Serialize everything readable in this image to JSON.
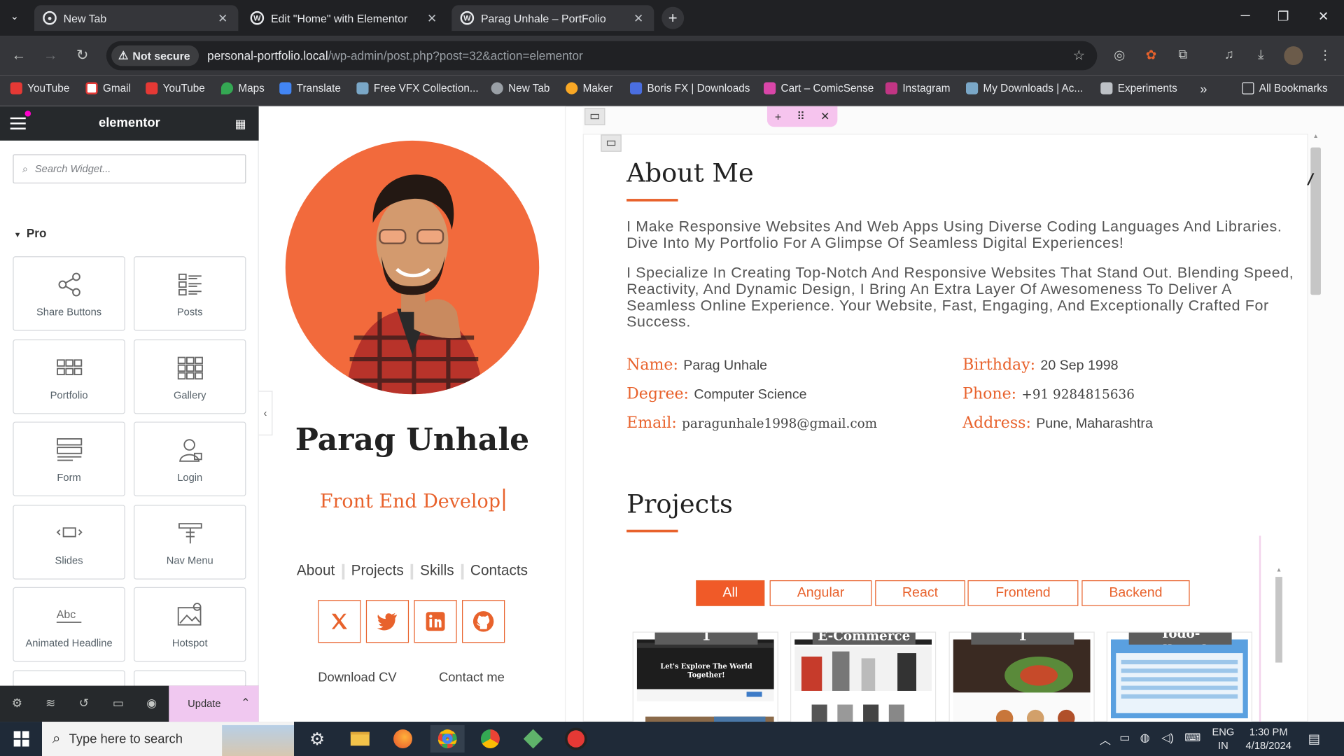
{
  "browser": {
    "tabs": [
      {
        "title": "New Tab"
      },
      {
        "title": "Edit \"Home\" with Elementor"
      },
      {
        "title": "Parag Unhale – PortFolio"
      }
    ],
    "security_label": "Not secure",
    "url_host": "personal-portfolio.local",
    "url_path": "/wp-admin/post.php?post=32&action=elementor",
    "bookmarks": [
      "YouTube",
      "Gmail",
      "YouTube",
      "Maps",
      "Translate",
      "Free VFX Collection...",
      "New Tab",
      "Maker",
      "Boris FX | Downloads",
      "Cart – ComicSense",
      "Instagram",
      "My Downloads | Ac...",
      "Experiments"
    ],
    "all_bookmarks": "All Bookmarks",
    "more": "»"
  },
  "elementor": {
    "logo": "elementor",
    "search_placeholder": "Search Widget...",
    "category": "Pro",
    "widgets": [
      "Share Buttons",
      "Posts",
      "Portfolio",
      "Gallery",
      "Form",
      "Login",
      "Slides",
      "Nav Menu",
      "Animated Headline",
      "Hotspot"
    ],
    "update_label": "Update"
  },
  "profile": {
    "name": "Parag Unhale",
    "title_typed": "Front End Develop",
    "nav": [
      "About",
      "Projects",
      "Skills",
      "Contacts"
    ],
    "download_cv": "Download CV",
    "contact_me": "Contact me"
  },
  "about": {
    "heading": "About Me",
    "para1": "I Make Responsive Websites And Web Apps Using Diverse Coding Languages And Libraries. Dive Into My Portfolio For A Glimpse Of Seamless Digital Experiences!",
    "para2": "I Specialize In Creating Top-Notch And Responsive Websites That Stand Out. Blending Speed, Reactivity, And Dynamic Design, I Bring An Extra Layer Of Awesomeness To Deliver A Seamless Online Experience. Your Website, Fast, Engaging, And Exceptionally Crafted For Success.",
    "info": {
      "name_label": "Name:",
      "name_value": "Parag Unhale",
      "degree_label": "Degree:",
      "degree_value": "Computer Science",
      "email_label": "Email:",
      "email_value": "paragunhale1998@gmail.com",
      "birthday_label": "Birthday:",
      "birthday_value": "20 Sep 1998",
      "phone_label": "Phone:",
      "phone_value": "+91 9284815636",
      "address_label": "Address:",
      "address_value": "Pune, Maharashtra"
    }
  },
  "projects": {
    "heading": "Projects",
    "filters": [
      "All",
      "Angular",
      "React",
      "Frontend",
      "Backend"
    ],
    "active_filter": "All",
    "cards": [
      {
        "tag": "1",
        "caption": "Let's Explore The World Together!"
      },
      {
        "tag": "E-Commerce",
        "caption": ""
      },
      {
        "tag": "1",
        "caption": ""
      },
      {
        "tag": "Todo-Fullstack-Angular",
        "caption": ""
      }
    ]
  },
  "taskbar": {
    "search_placeholder": "Type here to search",
    "lang1": "ENG",
    "lang2": "IN",
    "time": "1:30 PM",
    "date": "4/18/2024"
  },
  "colors": {
    "accent": "#e8622c",
    "elementor_dark": "#26292c",
    "chrome_dark": "#202124"
  }
}
